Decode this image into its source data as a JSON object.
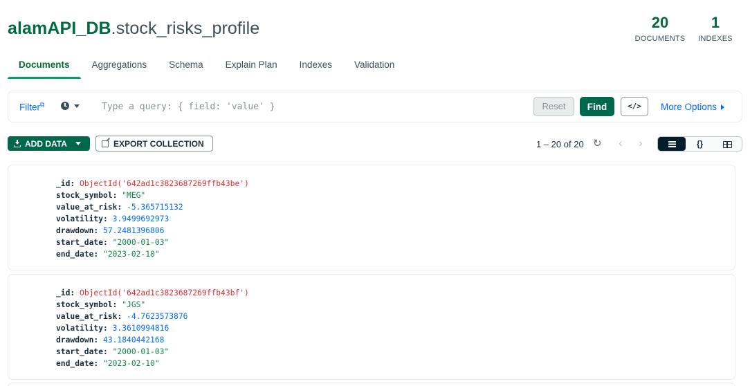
{
  "header": {
    "db_name": "alamAPI_DB",
    "collection_name": ".stock_risks_profile",
    "documents_count": "20",
    "documents_label": "DOCUMENTS",
    "indexes_count": "1",
    "indexes_label": "INDEXES"
  },
  "tabs": [
    {
      "label": "Documents",
      "active": true
    },
    {
      "label": "Aggregations"
    },
    {
      "label": "Schema"
    },
    {
      "label": "Explain Plan"
    },
    {
      "label": "Indexes"
    },
    {
      "label": "Validation"
    }
  ],
  "querybar": {
    "filter_label": "Filter",
    "filter_icon": "external-link-icon",
    "history_icon": "clock-icon",
    "placeholder": "Type a query: { field: 'value' }",
    "reset_label": "Reset",
    "find_label": "Find",
    "code_label": "</>",
    "more_options_label": "More Options"
  },
  "toolbar": {
    "add_data_label": "ADD DATA",
    "export_label": "EXPORT COLLECTION",
    "pagination": "1 – 20 of 20",
    "refresh_icon": "↻",
    "prev_icon": "‹",
    "next_icon": "›",
    "json_view_label": "{}"
  },
  "documents": [
    {
      "id_key": "_id: ",
      "id_value": "ObjectId('642ad1c3823687269ffb43be')",
      "stock_symbol": "\"MEG\"",
      "value_at_risk": "-5.365715132",
      "volatility": "3.9499692973",
      "drawdown": "57.2481396806",
      "start_date": "\"2000-01-03\"",
      "end_date": "\"2023-02-10\""
    },
    {
      "id_key": "_id: ",
      "id_value": "ObjectId('642ad1c3823687269ffb43bf')",
      "stock_symbol": "\"JGS\"",
      "value_at_risk": "-4.7623573876",
      "volatility": "3.3610994816",
      "drawdown": "43.1840442168",
      "start_date": "\"2000-01-03\"",
      "end_date": "\"2023-02-10\""
    }
  ],
  "field_keys": {
    "stock_symbol": "stock_symbol: ",
    "value_at_risk": "value_at_risk: ",
    "volatility": "volatility: ",
    "drawdown": "drawdown: ",
    "start_date": "start_date: ",
    "end_date": "end_date: "
  },
  "colors": {
    "brand_green": "#00684a",
    "link_blue": "#016bf8",
    "object_id_red": "#db3030",
    "string_green": "#12824d"
  }
}
